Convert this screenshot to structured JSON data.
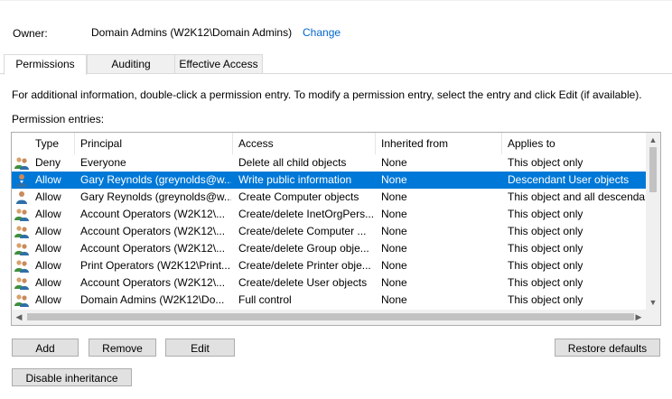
{
  "owner": {
    "label": "Owner:",
    "value": "Domain Admins (W2K12\\Domain Admins)",
    "change_link": "Change"
  },
  "tabs": [
    {
      "label": "Permissions",
      "active": true
    },
    {
      "label": "Auditing",
      "active": false
    },
    {
      "label": "Effective Access",
      "active": false
    }
  ],
  "info_text": "For additional information, double-click a permission entry. To modify a permission entry, select the entry and click Edit (if available).",
  "entries_label": "Permission entries:",
  "columns": [
    "Type",
    "Principal",
    "Access",
    "Inherited from",
    "Applies to"
  ],
  "entries": [
    {
      "type": "Deny",
      "principal": "Everyone",
      "access": "Delete all child objects",
      "inherited": "None",
      "applies": "This object only",
      "icon": "group-icon"
    },
    {
      "type": "Allow",
      "principal": "Gary Reynolds (greynolds@w...",
      "access": "Write public information",
      "inherited": "None",
      "applies": "Descendant User objects",
      "icon": "user-icon",
      "selected": true
    },
    {
      "type": "Allow",
      "principal": "Gary Reynolds (greynolds@w...",
      "access": "Create Computer objects",
      "inherited": "None",
      "applies": "This object and all descendants",
      "icon": "user-icon"
    },
    {
      "type": "Allow",
      "principal": "Account Operators (W2K12\\...",
      "access": "Create/delete InetOrgPers...",
      "inherited": "None",
      "applies": "This object only",
      "icon": "group-icon"
    },
    {
      "type": "Allow",
      "principal": "Account Operators (W2K12\\...",
      "access": "Create/delete Computer ...",
      "inherited": "None",
      "applies": "This object only",
      "icon": "group-icon"
    },
    {
      "type": "Allow",
      "principal": "Account Operators (W2K12\\...",
      "access": "Create/delete Group obje...",
      "inherited": "None",
      "applies": "This object only",
      "icon": "group-icon"
    },
    {
      "type": "Allow",
      "principal": "Print Operators (W2K12\\Print...",
      "access": "Create/delete Printer obje...",
      "inherited": "None",
      "applies": "This object only",
      "icon": "group-icon"
    },
    {
      "type": "Allow",
      "principal": "Account Operators (W2K12\\...",
      "access": "Create/delete User objects",
      "inherited": "None",
      "applies": "This object only",
      "icon": "group-icon"
    },
    {
      "type": "Allow",
      "principal": "Domain Admins (W2K12\\Do...",
      "access": "Full control",
      "inherited": "None",
      "applies": "This object only",
      "icon": "group-icon"
    }
  ],
  "buttons": {
    "add": "Add",
    "remove": "Remove",
    "edit": "Edit",
    "restore_defaults": "Restore defaults",
    "disable_inheritance": "Disable inheritance"
  },
  "colors": {
    "selection": "#0078d7",
    "link": "#0066cc"
  }
}
